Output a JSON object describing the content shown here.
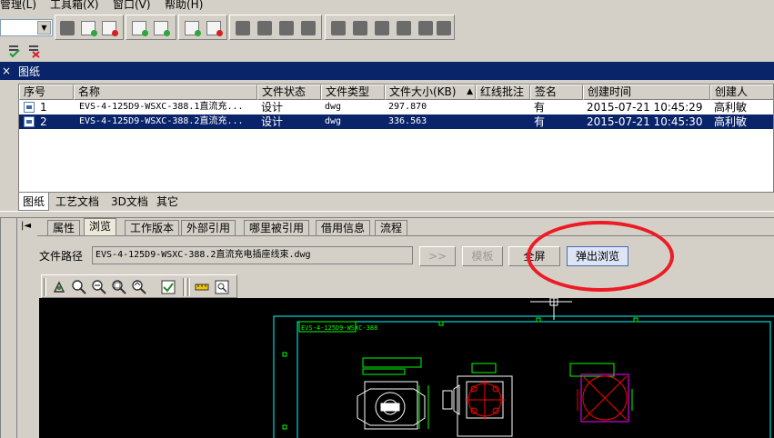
{
  "menu": {
    "items": [
      {
        "label": "管理(L)"
      },
      {
        "label": "工具箱(X)"
      },
      {
        "label": "窗口(V)"
      },
      {
        "label": "帮助(H)"
      }
    ]
  },
  "pane": {
    "title": "图纸",
    "close_icon": "×"
  },
  "grid": {
    "columns": [
      "序号",
      "名称",
      "文件状态",
      "文件类型",
      "文件大小(KB)",
      "红线批注",
      "签名",
      "创建时间",
      "创建人"
    ],
    "sort_indicator": "▲",
    "rows": [
      {
        "index": "1",
        "name": "EVS-4-125D9-WSXC-388.1直流充...",
        "status": "设计",
        "type": "dwg",
        "size": "297.870",
        "redline": "",
        "sign": "有",
        "created": "2015-07-21 10:45:29",
        "creator": "高利敏"
      },
      {
        "index": "2",
        "name": "EVS-4-125D9-WSXC-388.2直流充...",
        "status": "设计",
        "type": "dwg",
        "size": "336.563",
        "redline": "",
        "sign": "有",
        "created": "2015-07-21 10:45:30",
        "creator": "高利敏"
      }
    ],
    "tabs": [
      "图纸",
      "工艺文档",
      "3D文档",
      "其它"
    ]
  },
  "detail": {
    "first_icon": "|◄",
    "tabs": [
      "属性",
      "浏览",
      "工作版本",
      "外部引用",
      "哪里被引用",
      "借用信息",
      "流程"
    ],
    "path_label": "文件路径",
    "path_value": "EVS-4-125D9-WSXC-388.2直流充电插座线束.dwg",
    "browse_button": ">>",
    "template_button": "模板",
    "fullscreen_button": "全屏",
    "popup_button": "弹出浏览"
  },
  "drawing": {
    "title_tag": "EVS-4-125D9-WSXC-388"
  },
  "colors": {
    "selection": "#0a246a",
    "callout": "#ec1b24",
    "cad_frame": "#00ffff",
    "cad_green": "#00ff00",
    "cad_red": "#ff0000",
    "cad_magenta": "#ff00ff"
  }
}
